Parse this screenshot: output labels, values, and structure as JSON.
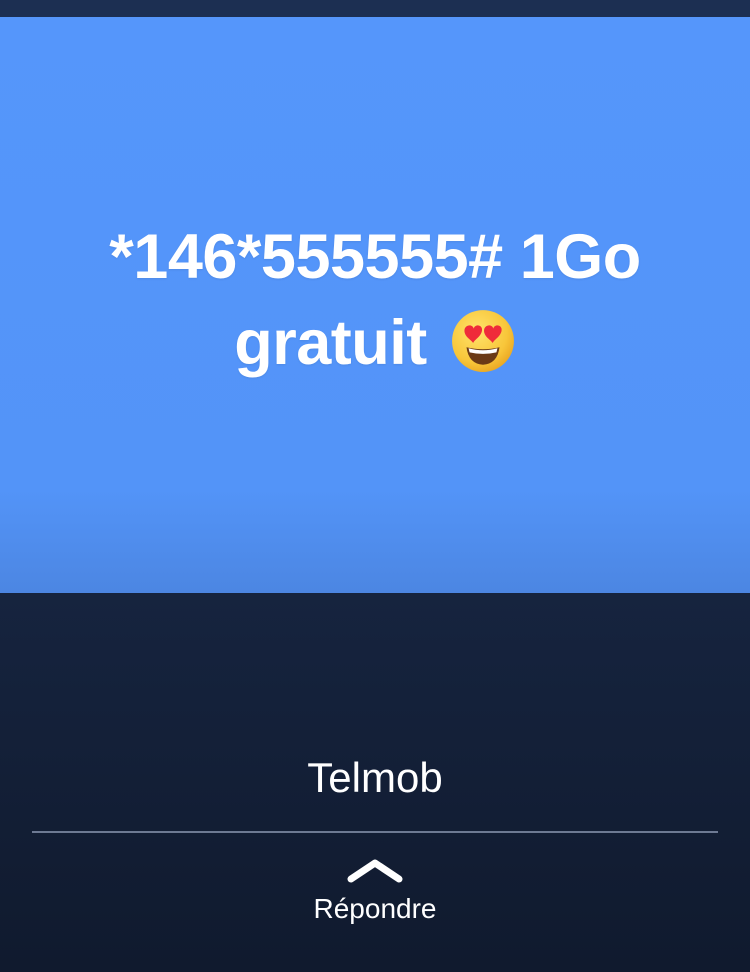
{
  "story": {
    "message": "*146*555555# 1Go gratuit",
    "emoji_icon": "heart-eyes-face-icon"
  },
  "sender": {
    "name": "Telmob"
  },
  "reply": {
    "label": "Répondre",
    "icon": "chevron-up-icon"
  },
  "colors": {
    "story_background": "#5596fb",
    "footer_background": "#16243f",
    "text": "#ffffff"
  }
}
